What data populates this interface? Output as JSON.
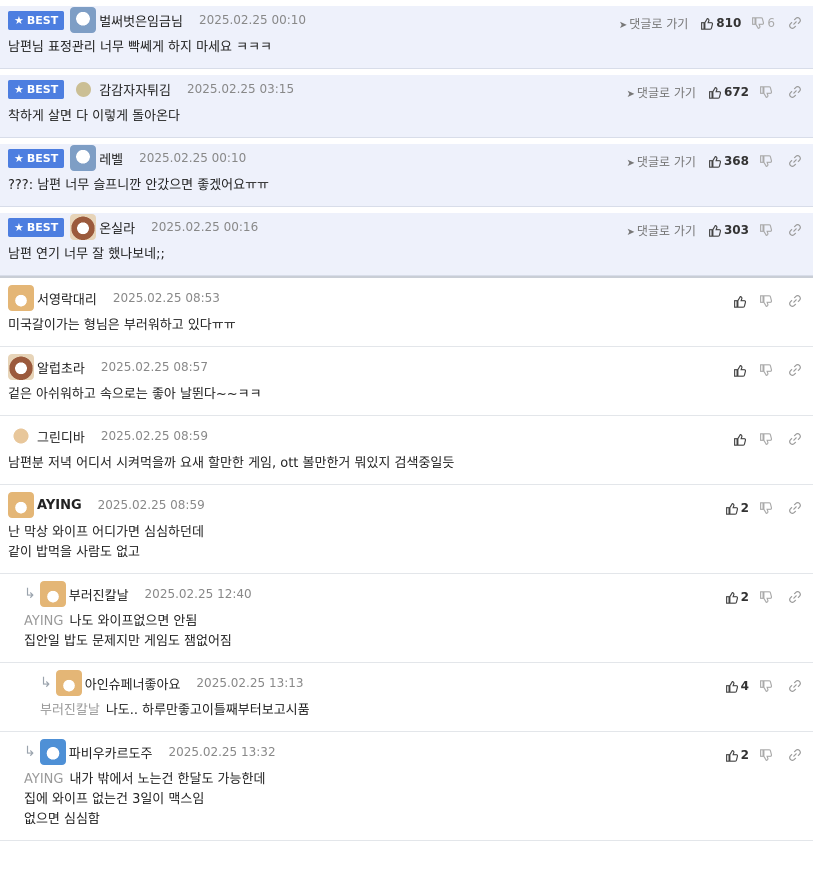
{
  "ui": {
    "best_label": "BEST",
    "goto_label": "댓글로 가기"
  },
  "comments": [
    {
      "best": true,
      "nick": "벌써벗은임금님",
      "date": "2025.02.25 00:10",
      "likes": "810",
      "dislikes": "6",
      "lines": [
        "남편님 표정관리 너무 빡쎄게 하지 마세요 ㅋㅋㅋ"
      ],
      "avatar": "bear-icon"
    },
    {
      "best": true,
      "nick": "감감자자튀김",
      "date": "2025.02.25 03:15",
      "likes": "672",
      "dislikes": "",
      "lines": [
        "착하게 살면 다 이렇게 돌아온다"
      ],
      "avatar": "dot-icon"
    },
    {
      "best": true,
      "nick": "레벨",
      "date": "2025.02.25 00:10",
      "likes": "368",
      "dislikes": "",
      "lines": [
        "???: 남편 너무 슬프니깐 안갔으면 좋겠어요ㅠㅠ"
      ],
      "avatar": "bear-icon"
    },
    {
      "best": true,
      "nick": "온실라",
      "date": "2025.02.25 00:16",
      "likes": "303",
      "dislikes": "",
      "lines": [
        "남편 연기 너무 잘 했나보네;;"
      ],
      "avatar": "dog-icon"
    },
    {
      "best": false,
      "nick": "서영락대리",
      "date": "2025.02.25 08:53",
      "likes": "",
      "lines": [
        "미국갈이가는 형님은 부러워하고 있다ㅠㅠ"
      ],
      "avatar": "fox-icon"
    },
    {
      "best": false,
      "nick": "알럽초라",
      "date": "2025.02.25 08:57",
      "likes": "",
      "lines": [
        "겉은 아쉬워하고 속으로는 좋아 날뛴다~~ㅋㅋ"
      ],
      "avatar": "dog-icon"
    },
    {
      "best": false,
      "nick": "그린디바",
      "date": "2025.02.25 08:59",
      "likes": "",
      "lines": [
        "남편분 저녁 어디서 시켜먹을까 요새 할만한 게임, ott 볼만한거 뭐있지 검색중일듯"
      ],
      "avatar": "pup-icon"
    },
    {
      "best": false,
      "nick": "AYING",
      "date": "2025.02.25 08:59",
      "likes": "2",
      "bold": true,
      "lines": [
        "난 막상 와이프 어디가면 심심하던데",
        "같이 밥먹을 사람도 없고"
      ],
      "avatar": "fox-icon"
    },
    {
      "best": false,
      "level": 1,
      "nick": "부러진칼날",
      "date": "2025.02.25 12:40",
      "likes": "2",
      "reply_to": "AYING",
      "lines": [
        "나도 와이프없으면 안됨",
        "집안일 밥도 문제지만 게임도 잼없어짐"
      ],
      "avatar": "fox-icon"
    },
    {
      "best": false,
      "level": 2,
      "nick": "아인슈페너좋아요",
      "date": "2025.02.25 13:13",
      "likes": "4",
      "reply_to": "부러진칼날",
      "lines": [
        "나도.. 하루만좋고이틀째부터보고시품"
      ],
      "avatar": "fox-icon"
    },
    {
      "best": false,
      "level": 1,
      "nick": "파비우카르도주",
      "date": "2025.02.25 13:32",
      "likes": "2",
      "reply_to": "AYING",
      "lines": [
        "내가 밖에서 노는건 한달도 가능한데",
        "집에 와이프 없는건 3일이 맥스임",
        "없으면 심심함"
      ],
      "avatar": "blue-icon"
    }
  ]
}
